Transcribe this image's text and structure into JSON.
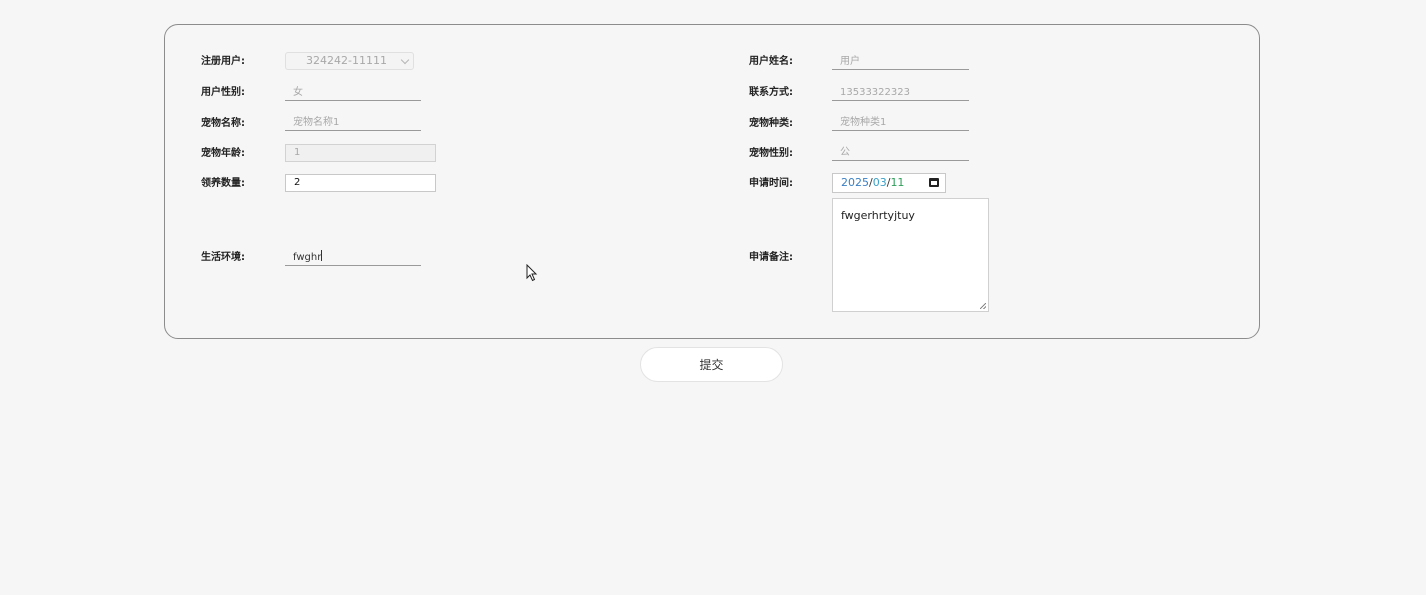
{
  "form": {
    "registered_user": {
      "label": "注册用户:",
      "value": "324242-11111"
    },
    "user_name": {
      "label": "用户姓名:",
      "placeholder": "用户"
    },
    "user_gender": {
      "label": "用户性别:",
      "placeholder": "女"
    },
    "contact": {
      "label": "联系方式:",
      "placeholder": "13533322323"
    },
    "pet_name": {
      "label": "宠物名称:",
      "placeholder": "宠物名称1"
    },
    "pet_species": {
      "label": "宠物种类:",
      "placeholder": "宠物种类1"
    },
    "pet_age": {
      "label": "宠物年龄:",
      "value": "1"
    },
    "pet_gender": {
      "label": "宠物性别:",
      "placeholder": "公"
    },
    "adopt_quantity": {
      "label": "领养数量:",
      "value": "2"
    },
    "apply_time": {
      "label": "申请时间:",
      "year": "2025",
      "month": "03",
      "day": "11",
      "sep": "/"
    },
    "living_env": {
      "label": "生活环境:",
      "value": "fwghr"
    },
    "apply_note": {
      "label": "申请备注:",
      "value": "fwgerhrtyjtuy"
    }
  },
  "submit_label": "提交",
  "icons": {
    "select_arrow": "chevron-down-icon",
    "date_picker": "calendar-icon",
    "cursor": "mouse-pointer-icon"
  }
}
